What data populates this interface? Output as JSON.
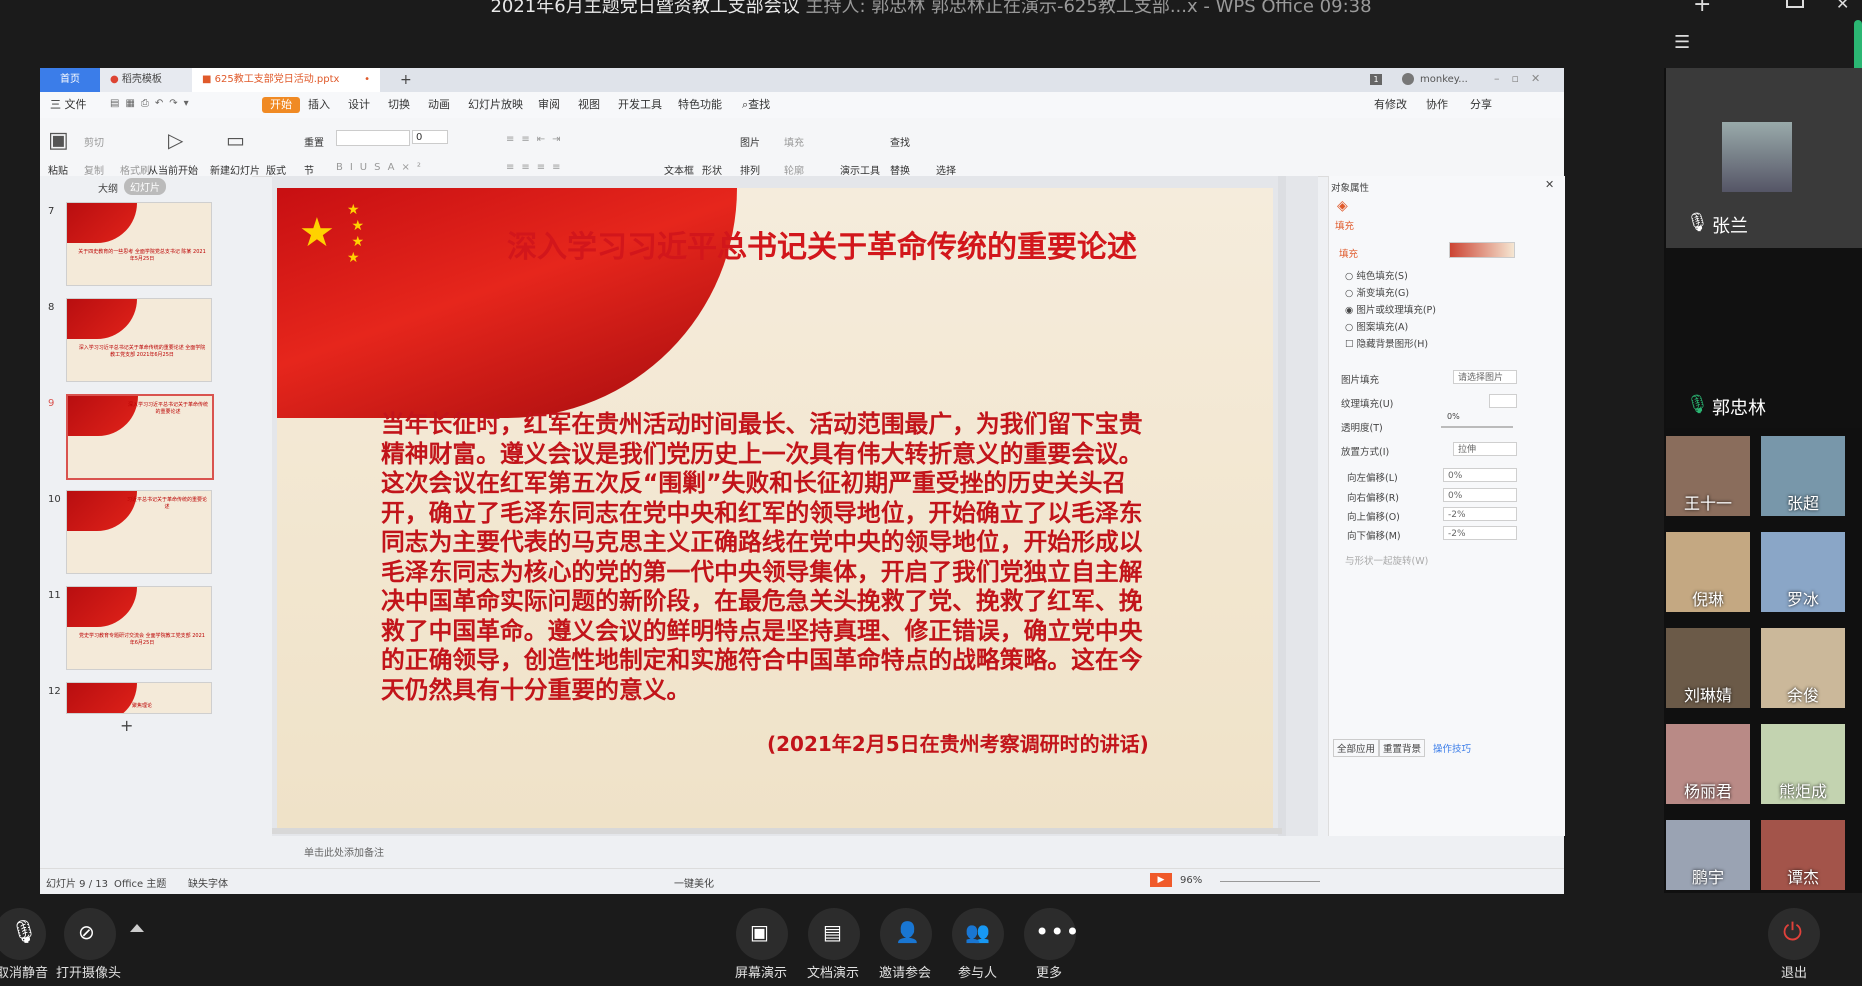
{
  "meeting": {
    "title": "2021年6月主题党日暨资教工支部会议",
    "host": "主持人: 郭忠林",
    "presenting": "郭忠林正在演示-625教工支部...x - WPS Office",
    "time": "09:38"
  },
  "wps": {
    "tabs": {
      "home": "首页",
      "template": "稻壳模板",
      "file": "625教工支部党日活动.pptx",
      "add": "+"
    },
    "user": "monkey...",
    "menu": [
      "三 文件",
      "开始",
      "插入",
      "设计",
      "切换",
      "动画",
      "幻灯片放映",
      "审阅",
      "视图",
      "开发工具",
      "特色功能",
      "查找"
    ],
    "menu_right": [
      "有修改",
      "协作",
      "分享"
    ],
    "ribbon": {
      "paste": "粘贴",
      "cut": "剪切",
      "copy": "复制",
      "format_painter": "格式刷",
      "from_current": "从当前开始",
      "new_slide": "新建幻灯片",
      "layout": "版式",
      "section": "节",
      "reset": "重置",
      "font_size": "0",
      "textbox": "文本框",
      "shape": "形状",
      "picture": "图片",
      "arrange": "排列",
      "fill": "填充",
      "outline": "轮廓",
      "presentation_tools": "演示工具",
      "find": "查找",
      "replace": "替换",
      "select": "选择"
    },
    "panel_tabs": {
      "outline": "大纲",
      "slides": "幻灯片"
    },
    "thumbnails": [
      {
        "num": "7",
        "text": "关于四史教育的一些思考 全面学院党总支书记 陈某 2021年5月25日"
      },
      {
        "num": "8",
        "text": "深入学习习近平总书记关于革命传统的重要论述 全面学院教工党支部 2021年6月25日"
      },
      {
        "num": "9",
        "text": "深入学习习近平总书记关于革命传统的重要论述"
      },
      {
        "num": "10",
        "text": "习近平总书记关于革命传统的重要论述"
      },
      {
        "num": "11",
        "text": "党史学习教育专题研讨交流会 全面学院教工党支部 2021年6月25日"
      },
      {
        "num": "12",
        "text": "聚焦理论"
      }
    ],
    "slide": {
      "title": "深入学习习近平总书记关于革命传统的重要论述",
      "body": "当年长征时，红军在贵州活动时间最长、活动范围最广，为我们留下宝贵精神财富。遵义会议是我们党历史上一次具有伟大转折意义的重要会议。这次会议在红军第五次反“围剿”失败和长征初期严重受挫的历史关头召开，确立了毛泽东同志在党中央和红军的领导地位，开始确立了以毛泽东同志为主要代表的马克思主义正确路线在党中央的领导地位，开始形成以毛泽东同志为核心的党的第一代中央领导集体，开启了我们党独立自主解决中国革命实际问题的新阶段，在最危急关头挽救了党、挽救了红军、挽救了中国革命。遵义会议的鲜明特点是坚持真理、修正错误，确立党中央的正确领导，创造性地制定和实施符合中国革命特点的战略策略。这在今天仍然具有十分重要的意义。",
      "source": "(2021年2月5日在贵州考察调研时的讲话)"
    },
    "notes_placeholder": "单击此处添加备注",
    "properties": {
      "header": "对象属性",
      "tab": "填充",
      "section": "填充",
      "options": [
        "纯色填充(S)",
        "渐变填充(G)",
        "图片或纹理填充(P)",
        "图案填充(A)"
      ],
      "selected_option": "图片或纹理填充(P)",
      "hide_bg": "隐藏背景图形(H)",
      "picture_fill_label": "图片填充",
      "picture_fill_value": "请选择图片",
      "texture_label": "纹理填充(U)",
      "transparency_label": "透明度(T)",
      "transparency_value": "0%",
      "placement_label": "放置方式(I)",
      "placement_value": "拉伸",
      "offsets": [
        {
          "label": "向左偏移(L)",
          "value": "0%"
        },
        {
          "label": "向右偏移(R)",
          "value": "0%"
        },
        {
          "label": "向上偏移(O)",
          "value": "-2%"
        },
        {
          "label": "向下偏移(M)",
          "value": "-2%"
        }
      ],
      "rotate_with_shape": "与形状一起旋转(W)",
      "apply_all": "全部应用",
      "reset_bg": "重置背景",
      "tips": "操作技巧"
    },
    "status": {
      "slide_index": "幻灯片 9 / 13",
      "theme": "Office 主题",
      "missing_font": "缺失字体",
      "beautify": "一键美化",
      "zoom": "96%"
    }
  },
  "participants": {
    "speaking_top": "张兰",
    "speaking_main": "郭忠林",
    "tiles": [
      "王十一",
      "张超",
      "倪琳",
      "罗冰",
      "刘琳婧",
      "余俊",
      "杨丽君",
      "熊炬成",
      "鹏宇",
      "谭杰"
    ]
  },
  "controls": [
    {
      "label": "取消静音",
      "icon": "mic-muted-icon"
    },
    {
      "label": "打开摄像头",
      "icon": "camera-off-icon"
    },
    {
      "label": "屏幕演示",
      "icon": "screen-share-icon"
    },
    {
      "label": "文档演示",
      "icon": "document-share-icon"
    },
    {
      "label": "邀请参会",
      "icon": "invite-icon"
    },
    {
      "label": "参与人",
      "icon": "participants-icon"
    },
    {
      "label": "更多",
      "icon": "more-icon"
    },
    {
      "label": "退出",
      "icon": "power-icon"
    }
  ],
  "colors": {
    "accent_blue": "#3b7de9",
    "ppt_red": "#d2161b",
    "exit_red": "#e0413b",
    "wps_orange": "#e05a2b"
  }
}
